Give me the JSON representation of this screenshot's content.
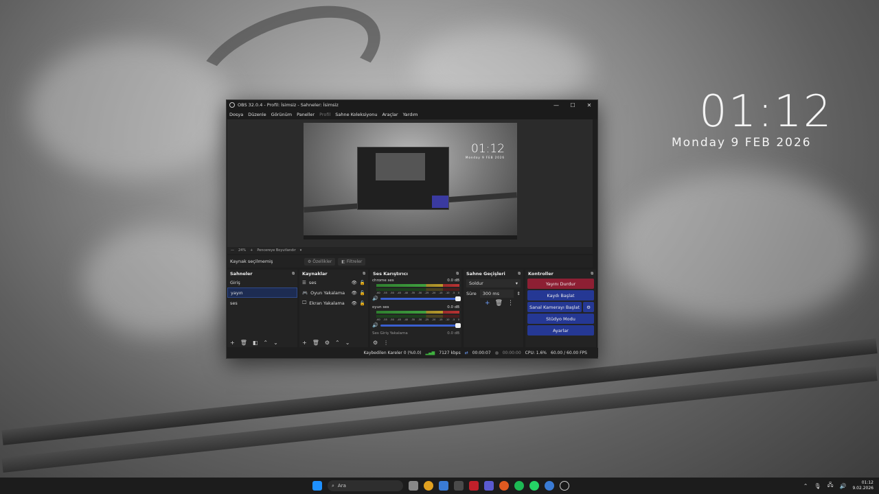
{
  "desktop": {
    "clock_time": "01:12",
    "clock_date": "Monday 9 FEB 2026"
  },
  "obs": {
    "title": "OBS 32.0.4 - Profil: İsimsiz - Sahneler: İsimsiz",
    "window_controls": {
      "minimize": "—",
      "maximize": "☐",
      "close": "✕"
    },
    "menu": [
      "Dosya",
      "Düzenle",
      "Görünüm",
      "Paneller",
      "Profil",
      "Sahne Koleksiyonu",
      "Araçlar",
      "Yardım"
    ],
    "preview": {
      "clock": "01:12",
      "date": "Monday 9 FEB 2026"
    },
    "zoom": {
      "minus": "—",
      "value": "24%",
      "plus": "+",
      "fit_label": "Pencereye Boyutlandır",
      "arrow": "▾"
    },
    "source_bar": {
      "no_selection": "Kaynak seçilmemiş",
      "properties": "Özellikler",
      "filters": "Filtreler"
    },
    "scenes": {
      "title": "Sahneler",
      "items": [
        "Giriş",
        "yayın",
        "ses"
      ],
      "selected": 1,
      "footer": [
        "+",
        "🗑",
        "◧",
        "⌃",
        "⌄"
      ]
    },
    "sources": {
      "title": "Kaynaklar",
      "items": [
        {
          "icon": "☰",
          "name": "ses"
        },
        {
          "icon": "🎮",
          "name": "Oyun Yakalama"
        },
        {
          "icon": "🖵",
          "name": "Ekran Yakalama"
        }
      ],
      "footer": [
        "+",
        "🗑",
        "⚙",
        "⌃",
        "⌄"
      ]
    },
    "mixer": {
      "title": "Ses Karıştırıcı",
      "channels": [
        {
          "name": "chrome ses",
          "db": "0.0 dB",
          "ticks": [
            "-60",
            "-55",
            "-50",
            "-45",
            "-40",
            "-35",
            "-30",
            "-25",
            "-20",
            "-15",
            "-10",
            "-5",
            "0"
          ]
        },
        {
          "name": "oyun ses",
          "db": "0.0 dB",
          "ticks": [
            "-60",
            "-55",
            "-50",
            "-45",
            "-40",
            "-35",
            "-30",
            "-25",
            "-20",
            "-15",
            "-10",
            "-5",
            "0"
          ]
        },
        {
          "name": "Ses Giriş Yakalama",
          "db": "0.0 dB",
          "ticks": []
        }
      ],
      "footer": [
        "⚙",
        "⋮"
      ]
    },
    "transitions": {
      "title": "Sahne Geçişleri",
      "selected": "Soldur",
      "duration_label": "Süre",
      "duration_value": "300 ms"
    },
    "controls": {
      "title": "Kontroller",
      "stop_stream": "Yayını Durdur",
      "start_record": "Kaydı Başlat",
      "virtual_cam": "Sanal Kamerayı Başlat",
      "studio_mode": "Stüdyo Modu",
      "settings": "Ayarlar"
    },
    "status": {
      "dropped": "Kaybedilen Kareler 0 (%0.0)",
      "bitrate": "7127 kbps",
      "stream_time": "00:00:07",
      "record_time": "00:00:00",
      "cpu": "CPU: 1.6%",
      "fps": "60.00 / 60.00 FPS"
    }
  },
  "taskbar": {
    "search_placeholder": "Ara",
    "icon_colors": [
      "#1e90ff",
      "#2e2e2e",
      "#e0a020",
      "#3a7bd5",
      "#4a4a4a",
      "#c0202a",
      "#5a5ad0",
      "#e05a20",
      "#1db954",
      "#25d366",
      "#3a7bd5",
      "#cc2233"
    ],
    "tray_icons": [
      "⌃",
      "🎙",
      "🖧",
      "🔊"
    ],
    "clock_time": "01:12",
    "clock_date": "9.02.2026"
  }
}
